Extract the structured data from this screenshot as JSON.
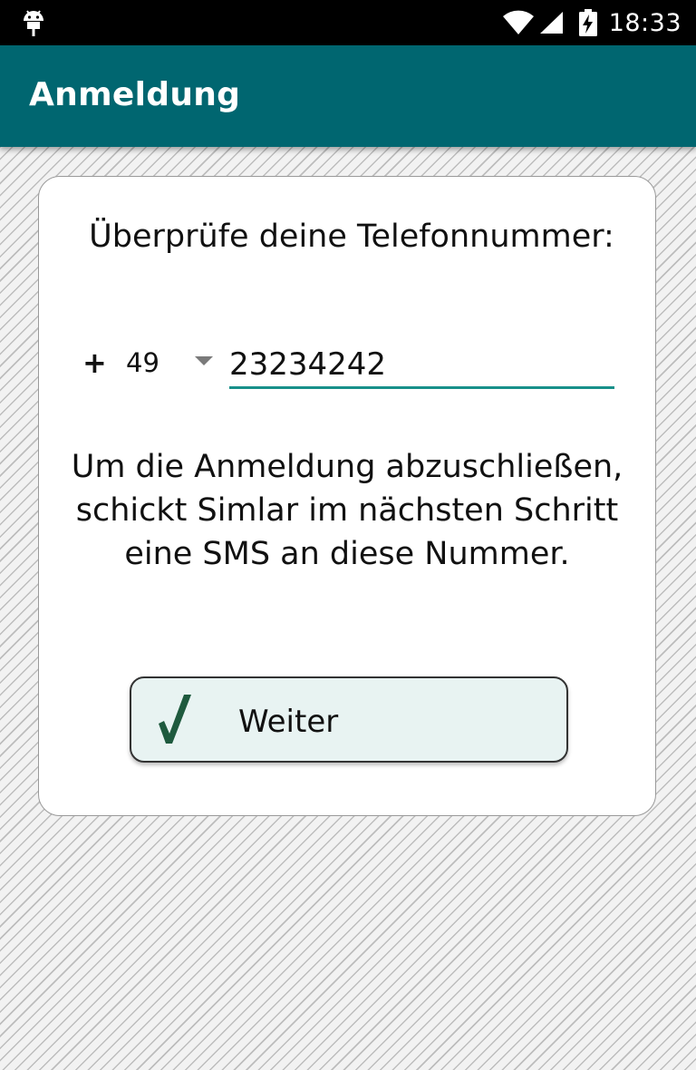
{
  "status_bar": {
    "time": "18:33",
    "icons": [
      "android-icon",
      "wifi-icon",
      "signal-icon",
      "battery-charging-icon"
    ]
  },
  "app_bar": {
    "title": "Anmeldung",
    "color": "#006670"
  },
  "card": {
    "heading": "Überprüfe deine Telefonnummer:",
    "phone": {
      "prefix": "+",
      "country_code": "49",
      "number": "23234242",
      "underline_color": "#17908a"
    },
    "info_text": "Um die Anmeldung abzuschließen, schickt Simlar im nächsten Schritt eine SMS an diese Nummer.",
    "button": {
      "label": "Weiter",
      "icon": "checkmark-icon",
      "background": "#e8f3f2",
      "icon_color": "#1e5a3e"
    }
  }
}
